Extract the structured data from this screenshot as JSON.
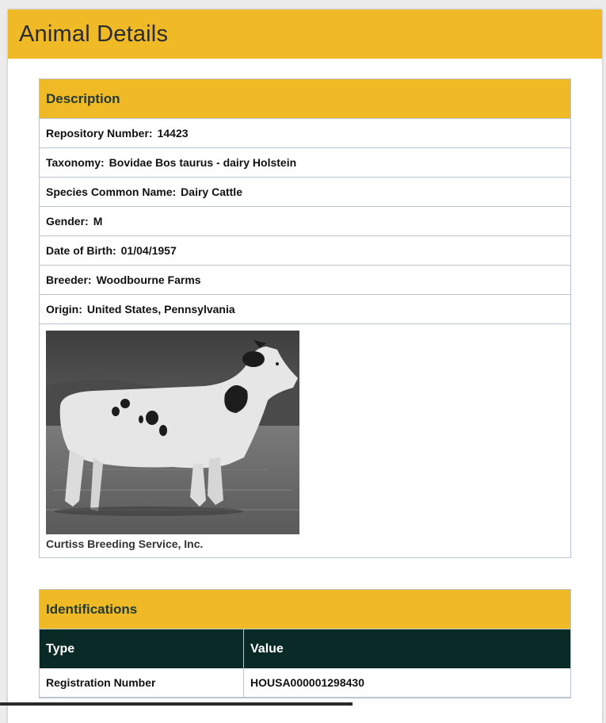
{
  "page": {
    "title": "Animal Details"
  },
  "description": {
    "heading": "Description",
    "fields": [
      {
        "label": "Repository Number",
        "value": "14423"
      },
      {
        "label": "Taxonomy",
        "value": "Bovidae Bos taurus - dairy Holstein"
      },
      {
        "label": "Species Common Name",
        "value": "Dairy Cattle"
      },
      {
        "label": "Gender",
        "value": "M"
      },
      {
        "label": "Date of Birth",
        "value": "01/04/1957"
      },
      {
        "label": "Breeder",
        "value": "Woodbourne Farms"
      },
      {
        "label": "Origin",
        "value": "United States, Pennsylvania"
      }
    ],
    "photo_caption": "Curtiss Breeding Service, Inc."
  },
  "identifications": {
    "heading": "Identifications",
    "columns": [
      "Type",
      "Value"
    ],
    "rows": [
      {
        "type": "Registration Number",
        "value": "HOUSA000001298430"
      }
    ]
  },
  "colors": {
    "header_gold": "#f0b926",
    "table_header_dark": "#0a2a27",
    "border": "#b9c6d2"
  }
}
